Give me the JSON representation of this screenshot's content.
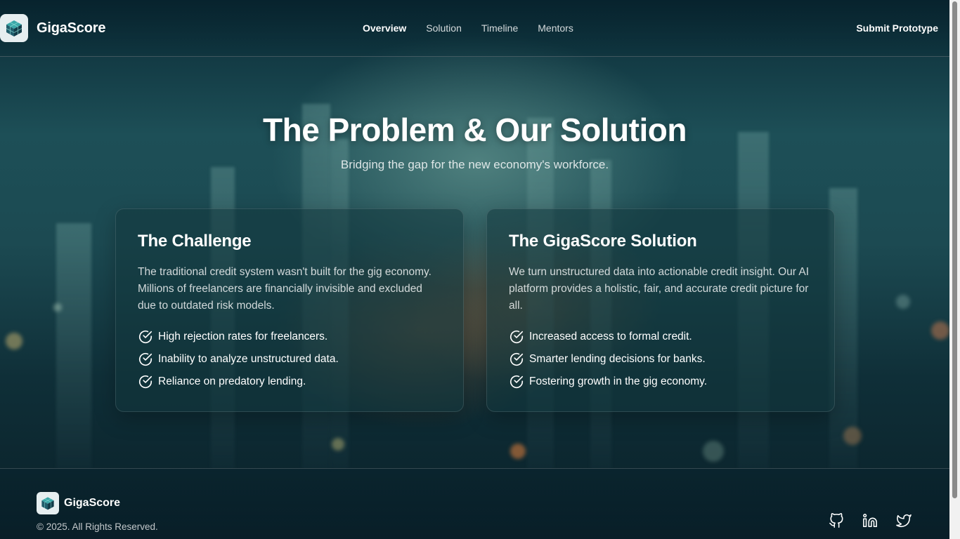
{
  "header": {
    "brand": "GigaScore",
    "nav": [
      {
        "label": "Overview",
        "active": true
      },
      {
        "label": "Solution",
        "active": false
      },
      {
        "label": "Timeline",
        "active": false
      },
      {
        "label": "Mentors",
        "active": false
      }
    ],
    "cta_label": "Submit Prototype"
  },
  "hero": {
    "title": "The Problem & Our Solution",
    "subtitle": "Bridging the gap for the new economy's workforce."
  },
  "challenge": {
    "title": "The Challenge",
    "description": "The traditional credit system wasn't built for the gig economy. Millions of freelancers are financially invisible and excluded due to outdated risk models.",
    "points": [
      "High rejection rates for freelancers.",
      "Inability to analyze unstructured data.",
      "Reliance on predatory lending."
    ]
  },
  "solution": {
    "title": "The GigaScore Solution",
    "description": "We turn unstructured data into actionable credit insight. Our AI platform provides a holistic, fair, and accurate credit picture for all.",
    "points": [
      "Increased access to formal credit.",
      "Smarter lending decisions for banks.",
      "Fostering growth in the gig economy."
    ]
  },
  "footer": {
    "brand": "GigaScore",
    "copyright": "© 2025. All Rights Reserved."
  },
  "icons": {
    "logo": "isometric-cube-logo-icon",
    "check": "check-circle-icon",
    "socials": [
      "github-icon",
      "linkedin-icon",
      "twitter-icon"
    ]
  },
  "colors": {
    "accent": "#ffffff",
    "background": "#1d4f57",
    "card": "#12373c"
  }
}
